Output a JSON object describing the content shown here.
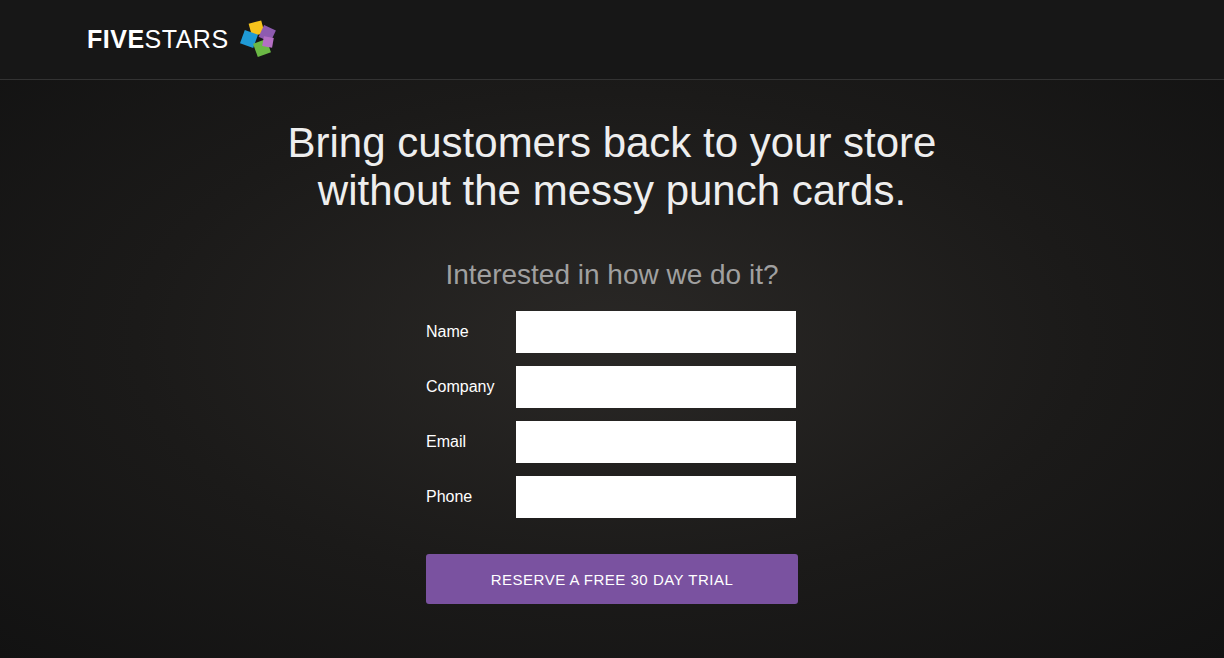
{
  "header": {
    "logo": {
      "bold": "FIVE",
      "light": "STARS"
    }
  },
  "hero": {
    "headline": [
      "Bring customers back to your store",
      "without the messy punch cards."
    ],
    "subheadline": "Interested in how we do it?"
  },
  "form": {
    "fields": [
      {
        "label": "Name",
        "value": ""
      },
      {
        "label": "Company",
        "value": ""
      },
      {
        "label": "Email",
        "value": ""
      },
      {
        "label": "Phone",
        "value": ""
      }
    ],
    "submit": "RESERVE A FREE 30 DAY TRIAL"
  }
}
